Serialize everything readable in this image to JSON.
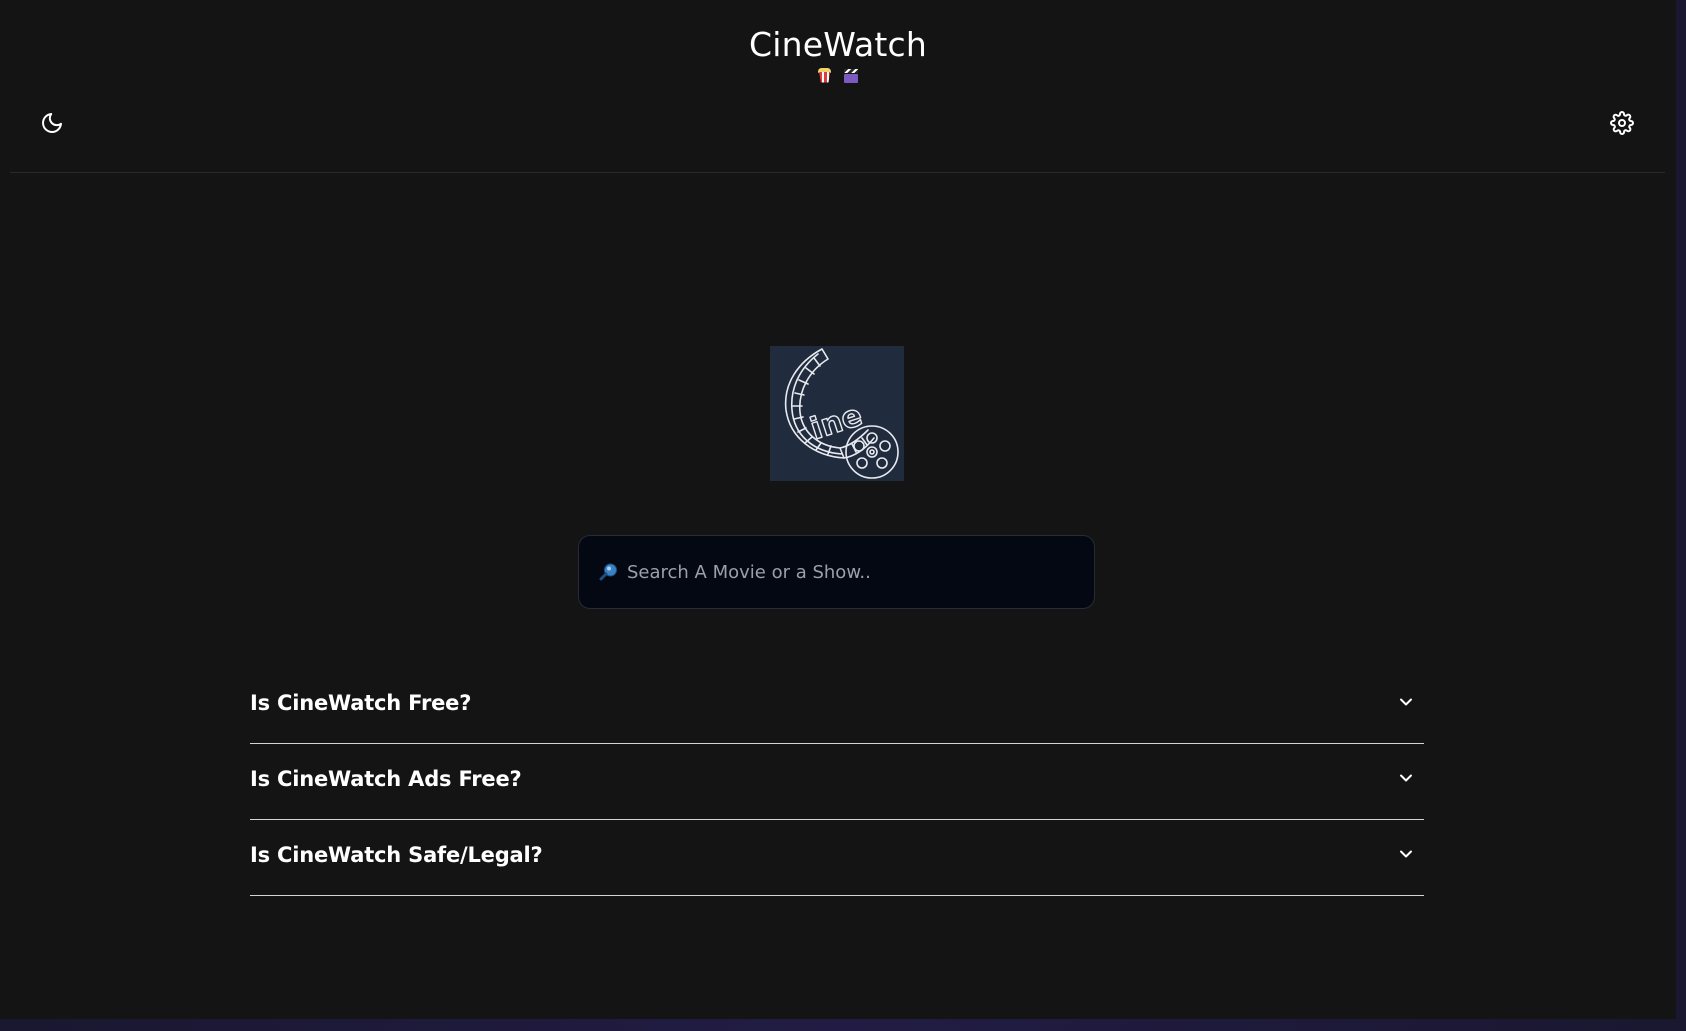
{
  "header": {
    "title": "CineWatch",
    "emoji_icons": [
      "popcorn-icon",
      "clapper-board-icon"
    ]
  },
  "toolbar": {
    "theme_toggle_icon": "moon-icon",
    "settings_icon": "gear-icon"
  },
  "logo": {
    "text": "ine",
    "icon": "film-reel-logo",
    "background": "#202b3d"
  },
  "search": {
    "placeholder": "Search A Movie or a Show..",
    "value": "",
    "icon": "search-icon"
  },
  "faq": {
    "items": [
      {
        "question": "Is CineWatch Free?"
      },
      {
        "question": "Is CineWatch Ads Free?"
      },
      {
        "question": "Is CineWatch Safe/Legal?"
      }
    ]
  },
  "colors": {
    "background": "#141415",
    "search_background": "#040812",
    "divider": "#d4d4d8",
    "text": "#ffffff"
  }
}
